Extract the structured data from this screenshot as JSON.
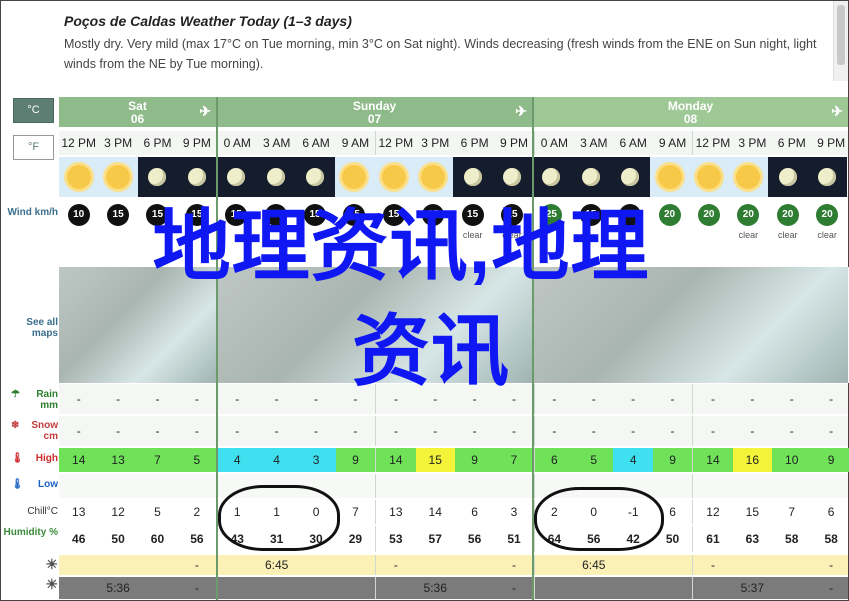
{
  "title": "Poços de Caldas Weather Today (1–3 days)",
  "description": "Mostly dry. Very mild (max 17°C on Tue morning, min 3°C on Sat night). Winds decreasing (fresh winds from the ENE on Sun night, light winds from the NE by Tue morning).",
  "units": {
    "celsius": "°C",
    "fahrenheit": "°F"
  },
  "days": [
    {
      "name": "Sat",
      "date": "06"
    },
    {
      "name": "Sunday",
      "date": "07"
    },
    {
      "name": "Monday",
      "date": "08"
    }
  ],
  "times": [
    "12 PM",
    "3 PM",
    "6 PM",
    "9 PM",
    "0 AM",
    "3 AM",
    "6 AM",
    "9 AM",
    "12 PM",
    "3 PM",
    "6 PM",
    "9 PM",
    "0 AM",
    "3 AM",
    "6 AM",
    "9 AM",
    "12 PM",
    "3 PM",
    "6 PM",
    "9 PM"
  ],
  "sky": [
    "day",
    "day",
    "night",
    "night",
    "night",
    "night",
    "night",
    "day",
    "day",
    "day",
    "night",
    "night",
    "night",
    "night",
    "night",
    "day",
    "day",
    "day",
    "night",
    "night"
  ],
  "labels": {
    "wind": "Wind km/h",
    "see_all_maps": "See all maps",
    "rain": "Rain mm",
    "snow": "Snow cm",
    "high": "High",
    "low": "Low",
    "chill": "Chill°C",
    "humidity": "Humidity %"
  },
  "wind": [
    "10",
    "15",
    "15",
    "15",
    "15",
    "15",
    "15",
    "15",
    "15",
    "15",
    "15",
    "15",
    "25",
    "15",
    "15",
    "20",
    "20",
    "20",
    "20",
    "20"
  ],
  "wind_sky": [
    "",
    "",
    "",
    "",
    "",
    "",
    "",
    "",
    "",
    "",
    "clear",
    "clear",
    "",
    "",
    "",
    "",
    "",
    "clear",
    "clear",
    "clear"
  ],
  "rain": [
    "-",
    "-",
    "-",
    "-",
    "-",
    "-",
    "-",
    "-",
    "-",
    "-",
    "-",
    "-",
    "-",
    "-",
    "-",
    "-",
    "-",
    "-",
    "-",
    "-"
  ],
  "snow": [
    "-",
    "-",
    "-",
    "-",
    "-",
    "-",
    "-",
    "-",
    "-",
    "-",
    "-",
    "-",
    "-",
    "-",
    "-",
    "-",
    "-",
    "-",
    "-",
    "-"
  ],
  "high": [
    "14",
    "13",
    "7",
    "5",
    "4",
    "4",
    "3",
    "9",
    "14",
    "15",
    "9",
    "7",
    "6",
    "5",
    "4",
    "9",
    "14",
    "16",
    "10",
    "9"
  ],
  "high_colors": [
    "#6fe25a",
    "#6fe25a",
    "#6fe25a",
    "#6fe25a",
    "#3fe1f0",
    "#3fe1f0",
    "#3fe1f0",
    "#6fe25a",
    "#6fe25a",
    "#f3f33a",
    "#6fe25a",
    "#6fe25a",
    "#6fe25a",
    "#6fe25a",
    "#3fe1f0",
    "#6fe25a",
    "#6fe25a",
    "#f3f33a",
    "#6fe25a",
    "#6fe25a"
  ],
  "low": [
    "",
    "",
    "",
    "",
    "",
    "",
    "",
    "",
    "",
    "",
    "",
    "",
    "",
    "",
    "",
    "",
    "",
    "",
    "",
    ""
  ],
  "chill": [
    "13",
    "12",
    "5",
    "2",
    "1",
    "1",
    "0",
    "7",
    "13",
    "14",
    "6",
    "3",
    "2",
    "0",
    "-1",
    "6",
    "12",
    "15",
    "7",
    "6"
  ],
  "humidity": [
    "46",
    "50",
    "60",
    "56",
    "43",
    "31",
    "30",
    "29",
    "53",
    "57",
    "56",
    "51",
    "64",
    "56",
    "42",
    "50",
    "61",
    "63",
    "58",
    "58"
  ],
  "sunrise": [
    "",
    "",
    "",
    "-",
    "",
    "6:45",
    "",
    "",
    "-",
    "",
    "",
    "-",
    "",
    "6:45",
    "",
    "",
    "-",
    "",
    "",
    "-"
  ],
  "sunset": [
    "",
    "5:36",
    "",
    "-",
    "",
    "",
    "",
    "",
    "",
    "5:36",
    "",
    "-",
    "",
    "",
    "",
    "",
    "",
    "5:37",
    "",
    "-"
  ],
  "watermark_line1": "地理资讯,地理",
  "watermark_line2": "资讯"
}
